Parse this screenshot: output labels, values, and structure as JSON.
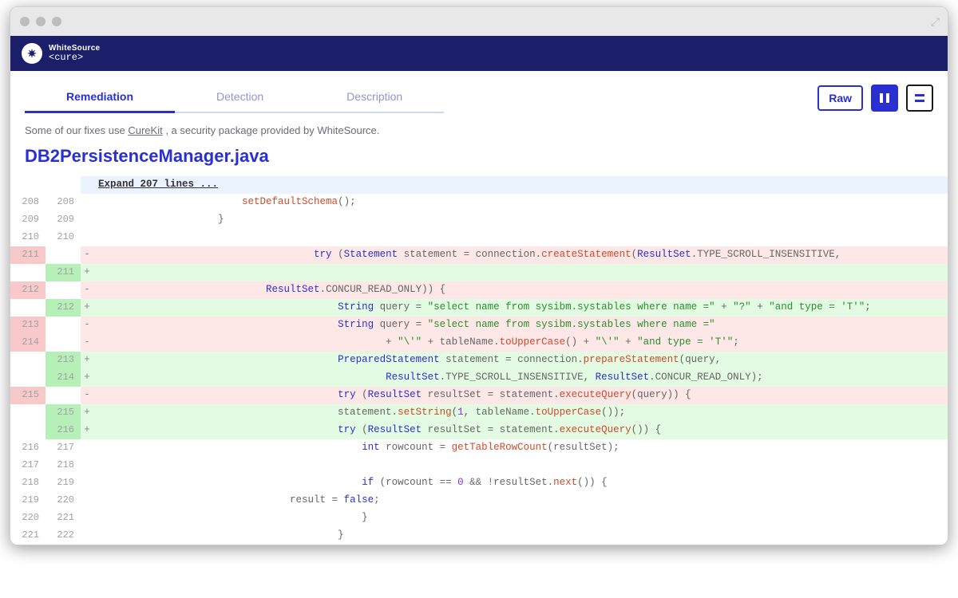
{
  "brand": {
    "top": "WhiteSource",
    "bottom": "<cure>"
  },
  "tabs": [
    {
      "label": "Remediation",
      "active": true
    },
    {
      "label": "Detection",
      "active": false
    },
    {
      "label": "Description",
      "active": false
    }
  ],
  "toolbar": {
    "raw": "Raw"
  },
  "hint": {
    "prefix": "Some of our fixes use ",
    "link": "CureKit",
    "suffix": " , a security package provided by WhiteSource."
  },
  "file": {
    "name": "DB2PersistenceManager.java"
  },
  "expand": {
    "label": "Expand 207 lines ..."
  },
  "diff": [
    {
      "old": "208",
      "new": "208",
      "type": "ctx",
      "tokens": [
        {
          "c": "punct",
          "t": "                        "
        },
        {
          "c": "fn",
          "t": "setDefaultSchema"
        },
        {
          "c": "punct",
          "t": "();"
        }
      ]
    },
    {
      "old": "209",
      "new": "209",
      "type": "ctx",
      "tokens": [
        {
          "c": "punct",
          "t": "                    }"
        }
      ]
    },
    {
      "old": "210",
      "new": "210",
      "type": "ctx",
      "tokens": [
        {
          "c": "punct",
          "t": " "
        }
      ]
    },
    {
      "old": "211",
      "new": "",
      "type": "del",
      "tokens": [
        {
          "c": "punct",
          "t": "                                    "
        },
        {
          "c": "kw",
          "t": "try"
        },
        {
          "c": "punct",
          "t": " ("
        },
        {
          "c": "kw",
          "t": "Statement"
        },
        {
          "c": "punct",
          "t": " statement = connection."
        },
        {
          "c": "fn",
          "t": "createStatement"
        },
        {
          "c": "punct",
          "t": "("
        },
        {
          "c": "kw",
          "t": "ResultSet"
        },
        {
          "c": "punct",
          "t": ".TYPE_SCROLL_INSENSITIVE,"
        }
      ]
    },
    {
      "old": "",
      "new": "211",
      "type": "add",
      "tokens": [
        {
          "c": "punct",
          "t": " "
        }
      ]
    },
    {
      "old": "212",
      "new": "",
      "type": "del",
      "tokens": [
        {
          "c": "punct",
          "t": "                            "
        },
        {
          "c": "kw",
          "t": "ResultSet"
        },
        {
          "c": "punct",
          "t": ".CONCUR_READ_ONLY)) {"
        }
      ]
    },
    {
      "old": "",
      "new": "212",
      "type": "add",
      "tokens": [
        {
          "c": "punct",
          "t": "                                        "
        },
        {
          "c": "kw",
          "t": "String"
        },
        {
          "c": "punct",
          "t": " query = "
        },
        {
          "c": "str",
          "t": "\"select name from sysibm.systables where name =\""
        },
        {
          "c": "punct",
          "t": " + "
        },
        {
          "c": "str",
          "t": "\"?\""
        },
        {
          "c": "punct",
          "t": " + "
        },
        {
          "c": "str",
          "t": "\"and type = 'T'\""
        },
        {
          "c": "punct",
          "t": ";"
        }
      ]
    },
    {
      "old": "213",
      "new": "",
      "type": "del",
      "tokens": [
        {
          "c": "punct",
          "t": "                                        "
        },
        {
          "c": "kw",
          "t": "String"
        },
        {
          "c": "punct",
          "t": " query = "
        },
        {
          "c": "str",
          "t": "\"select name from sysibm.systables where name =\""
        }
      ]
    },
    {
      "old": "214",
      "new": "",
      "type": "del",
      "tokens": [
        {
          "c": "punct",
          "t": "                                                + "
        },
        {
          "c": "str",
          "t": "\"\\'\""
        },
        {
          "c": "punct",
          "t": " + tableName."
        },
        {
          "c": "fn",
          "t": "toUpperCase"
        },
        {
          "c": "punct",
          "t": "() + "
        },
        {
          "c": "str",
          "t": "\"\\'\""
        },
        {
          "c": "punct",
          "t": " + "
        },
        {
          "c": "str",
          "t": "\"and type = 'T'\""
        },
        {
          "c": "punct",
          "t": ";"
        }
      ]
    },
    {
      "old": "",
      "new": "213",
      "type": "add",
      "tokens": [
        {
          "c": "punct",
          "t": "                                        "
        },
        {
          "c": "kw",
          "t": "PreparedStatement"
        },
        {
          "c": "punct",
          "t": " statement = connection."
        },
        {
          "c": "fn",
          "t": "prepareStatement"
        },
        {
          "c": "punct",
          "t": "(query,"
        }
      ]
    },
    {
      "old": "",
      "new": "214",
      "type": "add",
      "tokens": [
        {
          "c": "punct",
          "t": "                                                "
        },
        {
          "c": "kw",
          "t": "ResultSet"
        },
        {
          "c": "punct",
          "t": ".TYPE_SCROLL_INSENSITIVE, "
        },
        {
          "c": "kw",
          "t": "ResultSet"
        },
        {
          "c": "punct",
          "t": ".CONCUR_READ_ONLY);"
        }
      ]
    },
    {
      "old": "215",
      "new": "",
      "type": "del",
      "tokens": [
        {
          "c": "punct",
          "t": "                                        "
        },
        {
          "c": "kw",
          "t": "try"
        },
        {
          "c": "punct",
          "t": " ("
        },
        {
          "c": "kw",
          "t": "ResultSet"
        },
        {
          "c": "punct",
          "t": " resultSet = statement."
        },
        {
          "c": "fn",
          "t": "executeQuery"
        },
        {
          "c": "punct",
          "t": "(query)) {"
        }
      ]
    },
    {
      "old": "",
      "new": "215",
      "type": "add",
      "tokens": [
        {
          "c": "punct",
          "t": "                                        statement."
        },
        {
          "c": "fn",
          "t": "setString"
        },
        {
          "c": "punct",
          "t": "("
        },
        {
          "c": "lit",
          "t": "1"
        },
        {
          "c": "punct",
          "t": ", tableName."
        },
        {
          "c": "fn",
          "t": "toUpperCase"
        },
        {
          "c": "punct",
          "t": "());"
        }
      ]
    },
    {
      "old": "",
      "new": "216",
      "type": "add",
      "tokens": [
        {
          "c": "punct",
          "t": "                                        "
        },
        {
          "c": "kw",
          "t": "try"
        },
        {
          "c": "punct",
          "t": " ("
        },
        {
          "c": "kw",
          "t": "ResultSet"
        },
        {
          "c": "punct",
          "t": " resultSet = statement."
        },
        {
          "c": "fn",
          "t": "executeQuery"
        },
        {
          "c": "punct",
          "t": "()) {"
        }
      ]
    },
    {
      "old": "216",
      "new": "217",
      "type": "ctx",
      "tokens": [
        {
          "c": "punct",
          "t": "                                            "
        },
        {
          "c": "kw",
          "t": "int"
        },
        {
          "c": "punct",
          "t": " rowcount = "
        },
        {
          "c": "fn",
          "t": "getTableRowCount"
        },
        {
          "c": "punct",
          "t": "(resultSet);"
        }
      ]
    },
    {
      "old": "217",
      "new": "218",
      "type": "ctx",
      "tokens": [
        {
          "c": "punct",
          "t": " "
        }
      ]
    },
    {
      "old": "218",
      "new": "219",
      "type": "ctx",
      "tokens": [
        {
          "c": "punct",
          "t": "                                            "
        },
        {
          "c": "kw",
          "t": "if"
        },
        {
          "c": "punct",
          "t": " (rowcount == "
        },
        {
          "c": "lit",
          "t": "0"
        },
        {
          "c": "punct",
          "t": " && !resultSet."
        },
        {
          "c": "fn",
          "t": "next"
        },
        {
          "c": "punct",
          "t": "()) {"
        }
      ]
    },
    {
      "old": "219",
      "new": "220",
      "type": "ctx",
      "tokens": [
        {
          "c": "punct",
          "t": "                                result = "
        },
        {
          "c": "kw",
          "t": "false"
        },
        {
          "c": "punct",
          "t": ";"
        }
      ]
    },
    {
      "old": "220",
      "new": "221",
      "type": "ctx",
      "tokens": [
        {
          "c": "punct",
          "t": "                                            }"
        }
      ]
    },
    {
      "old": "221",
      "new": "222",
      "type": "ctx",
      "tokens": [
        {
          "c": "punct",
          "t": "                                        }"
        }
      ]
    }
  ]
}
